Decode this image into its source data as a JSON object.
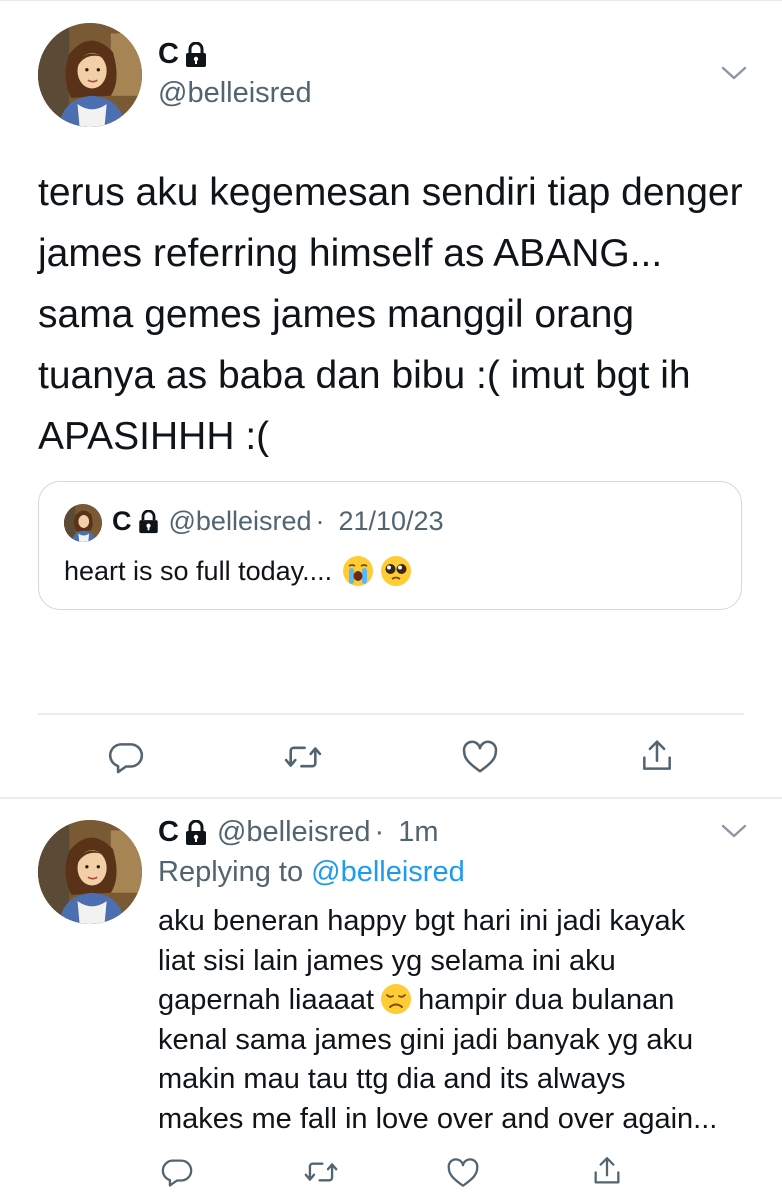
{
  "main_tweet": {
    "display_name": "C",
    "handle": "@belleisred",
    "text": "terus aku kegemesan sendiri tiap denger james referring himself as ABANG... sama gemes james manggil orang tuanya as baba dan bibu :( imut bgt ih APASIHHH :(",
    "avatar": "belle-avatar",
    "lock_icon": "lock-icon",
    "menu_icon": "chevron-down-icon"
  },
  "quoted_tweet": {
    "display_name": "C",
    "handle": "@belleisred",
    "separator": "·",
    "date": "21/10/23",
    "text": "heart is so full today....",
    "emojis": [
      "loudly-crying-face-emoji",
      "pleading-face-emoji"
    ]
  },
  "actions": {
    "reply_icon": "reply-icon",
    "retweet_icon": "retweet-icon",
    "like_icon": "heart-icon",
    "share_icon": "share-icon"
  },
  "reply_tweet": {
    "display_name": "C",
    "handle": "@belleisred",
    "separator": "·",
    "time": "1m",
    "replying_prefix": "Replying to",
    "replying_to": "@belleisred",
    "lines": {
      "l1": "aku beneran happy bgt hari ini jadi kayak",
      "l2": "liat sisi lain james yg selama ini aku",
      "l3a": "gapernah liaaaat",
      "l3b": "hampir dua bulanan",
      "l4": "kenal sama james gini jadi banyak yg aku",
      "l5": "makin mau tau ttg dia and its always",
      "l6": "makes me fall in love over and over again..."
    },
    "inline_emoji": "disappointed-face-emoji"
  },
  "colors": {
    "text": "#0f1419",
    "secondary": "#536471",
    "link": "#1d9bf0",
    "border": "#cfd9de"
  }
}
